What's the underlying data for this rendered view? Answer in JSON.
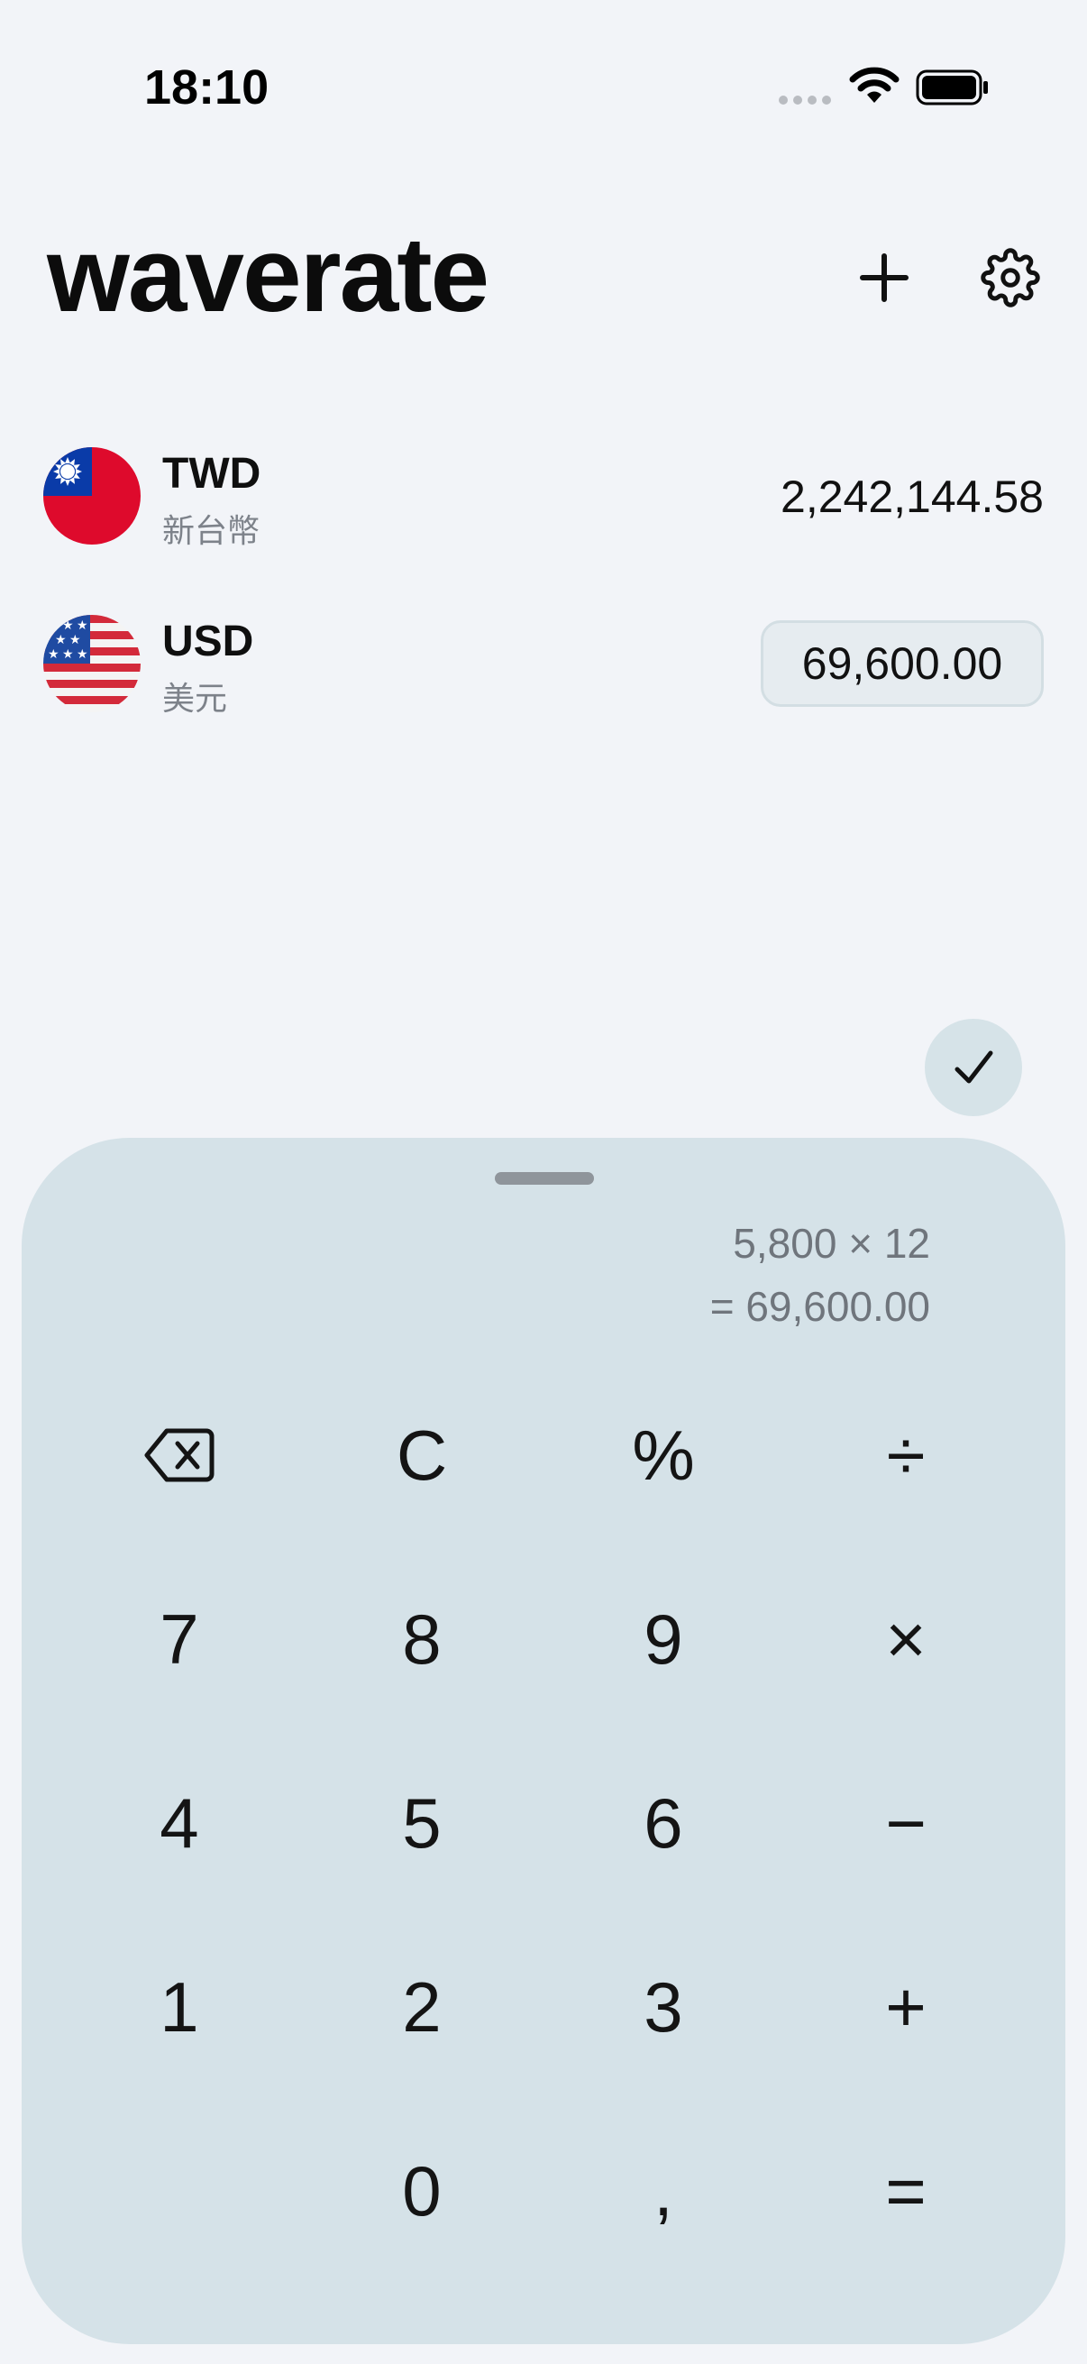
{
  "status": {
    "time": "18:10"
  },
  "app": {
    "title": "waverate"
  },
  "currencies": [
    {
      "code": "TWD",
      "name": "新台幣",
      "amount": "2,242,144.58"
    },
    {
      "code": "USD",
      "name": "美元",
      "amount": "69,600.00"
    }
  ],
  "calculator": {
    "expression": "5,800 × 12",
    "result": "= 69,600.00",
    "keys": {
      "clear": "C",
      "percent": "%",
      "divide": "÷",
      "seven": "7",
      "eight": "8",
      "nine": "9",
      "multiply": "×",
      "four": "4",
      "five": "5",
      "six": "6",
      "minus": "−",
      "one": "1",
      "two": "2",
      "three": "3",
      "plus": "+",
      "zero": "0",
      "comma": ",",
      "equals": "="
    }
  },
  "colors": {
    "background": "#f2f4f8",
    "sheet": "#d5e2e8",
    "secondary_text": "#7d828a",
    "twd_red": "#de0a2c",
    "twd_blue": "#0a3ba8",
    "usd_red": "#d32a3a",
    "usd_blue": "#1f4ba2"
  },
  "icons": {
    "add": "plus-icon",
    "settings": "gear-icon",
    "confirm": "checkmark-icon",
    "backspace": "backspace-icon",
    "wifi": "wifi-icon",
    "battery": "battery-icon"
  }
}
